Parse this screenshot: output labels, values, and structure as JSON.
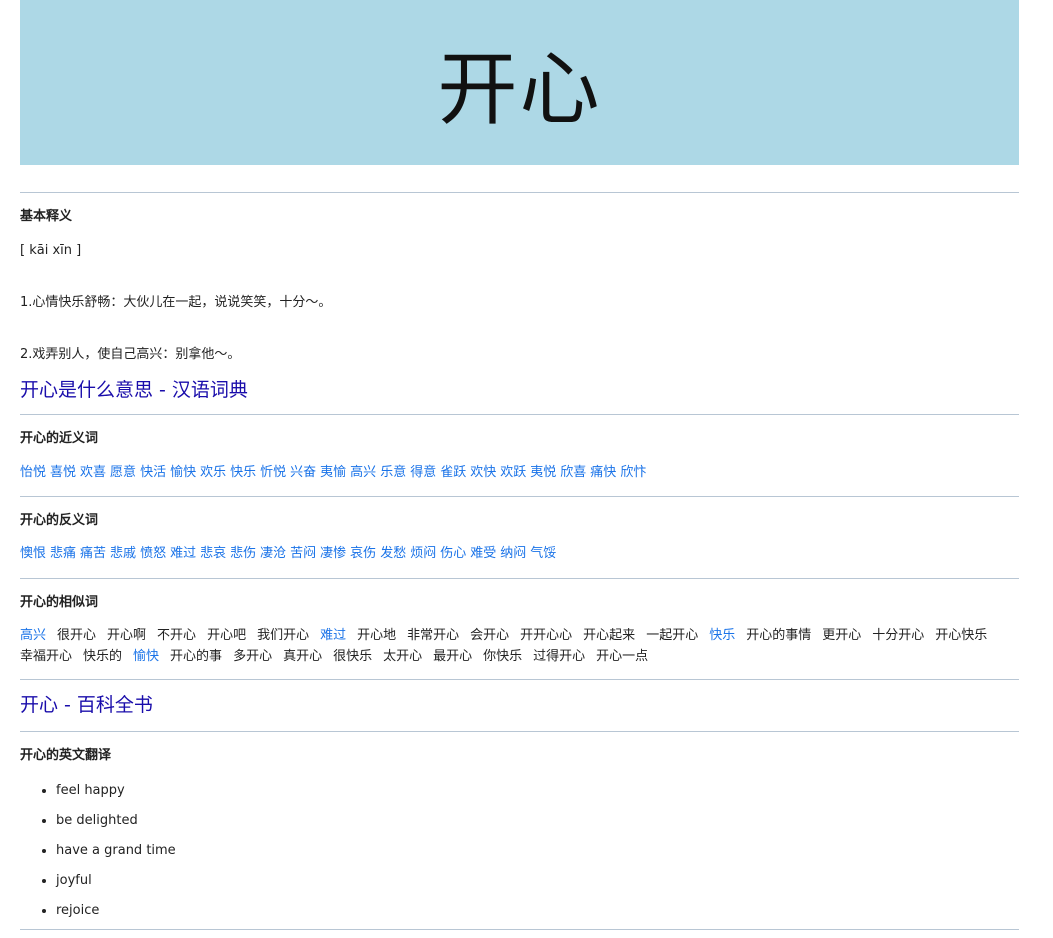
{
  "banner": {
    "title": "开心"
  },
  "basic": {
    "heading": "基本释义",
    "pinyin": "[ kāi xīn ]",
    "def1": "1.心情快乐舒畅：大伙儿在一起，说说笑笑，十分～。",
    "def2": "2.戏弄别人，使自己高兴：别拿他～。"
  },
  "dict_link": "开心是什么意思 - 汉语词典",
  "synonyms": {
    "heading": "开心的近义词",
    "items": [
      "怡悦",
      "喜悦",
      "欢喜",
      "愿意",
      "快活",
      "愉快",
      "欢乐",
      "快乐",
      "忻悦",
      "兴奋",
      "夷愉",
      "高兴",
      "乐意",
      "得意",
      "雀跃",
      "欢快",
      "欢跃",
      "夷悦",
      "欣喜",
      "痛快",
      "欣忭"
    ]
  },
  "antonyms": {
    "heading": "开心的反义词",
    "items": [
      "懊恨",
      "悲痛",
      "痛苦",
      "悲戚",
      "愤怒",
      "难过",
      "悲哀",
      "悲伤",
      "凄沧",
      "苦闷",
      "凄惨",
      "哀伤",
      "发愁",
      "烦闷",
      "伤心",
      "难受",
      "纳闷",
      "气馁"
    ]
  },
  "similar": {
    "heading": "开心的相似词",
    "items": [
      "高兴",
      "很开心",
      "开心啊",
      "不开心",
      "开心吧",
      "我们开心",
      "难过",
      "开心地",
      "非常开心",
      "会开心",
      "开开心心",
      "开心起来",
      "一起开心",
      "快乐",
      "开心的事情",
      "更开心",
      "十分开心",
      "开心快乐",
      "幸福开心",
      "快乐的",
      "愉快",
      "开心的事",
      "多开心",
      "真开心",
      "很快乐",
      "太开心",
      "最开心",
      "你快乐",
      "过得开心",
      "开心一点"
    ]
  },
  "baike_link": "开心 - 百科全书",
  "translation": {
    "heading": "开心的英文翻译",
    "items": [
      "feel happy",
      "be delighted",
      "have a grand time",
      "joyful",
      "rejoice"
    ]
  }
}
